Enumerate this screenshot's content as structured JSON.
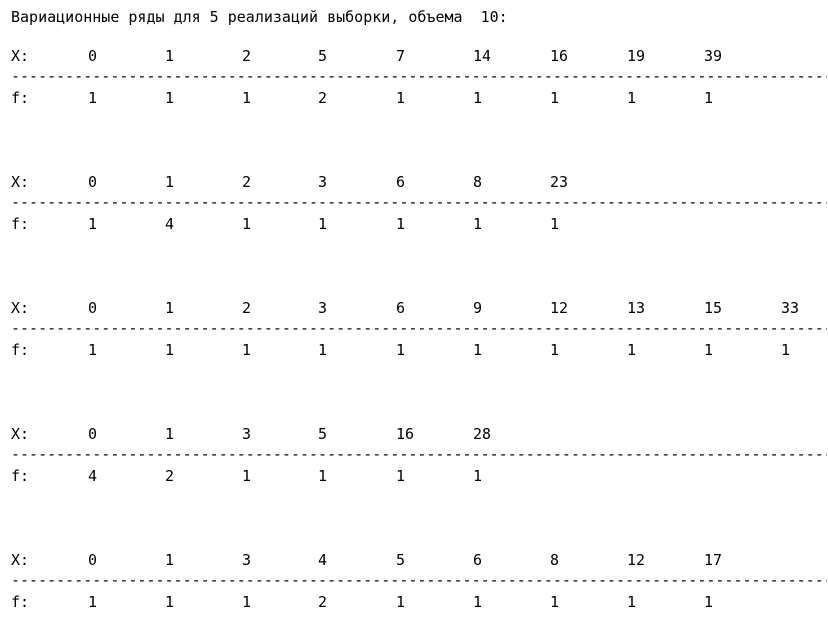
{
  "heading": "Вариационные ряды для 5 реализаций выборки, объема  10:",
  "x_label": "X:",
  "f_label": "f:",
  "separator": "--------------------------------------------------------------------------------------------------------------",
  "samples": [
    {
      "x": [
        "0",
        "1",
        "2",
        "5",
        "7",
        "14",
        "16",
        "19",
        "39"
      ],
      "f": [
        "1",
        "1",
        "1",
        "2",
        "1",
        "1",
        "1",
        "1",
        "1"
      ]
    },
    {
      "x": [
        "0",
        "1",
        "2",
        "3",
        "6",
        "8",
        "23"
      ],
      "f": [
        "1",
        "4",
        "1",
        "1",
        "1",
        "1",
        "1"
      ]
    },
    {
      "x": [
        "0",
        "1",
        "2",
        "3",
        "6",
        "9",
        "12",
        "13",
        "15",
        "33"
      ],
      "f": [
        "1",
        "1",
        "1",
        "1",
        "1",
        "1",
        "1",
        "1",
        "1",
        "1"
      ]
    },
    {
      "x": [
        "0",
        "1",
        "3",
        "5",
        "16",
        "28"
      ],
      "f": [
        "4",
        "2",
        "1",
        "1",
        "1",
        "1"
      ]
    },
    {
      "x": [
        "0",
        "1",
        "3",
        "4",
        "5",
        "6",
        "8",
        "12",
        "17"
      ],
      "f": [
        "1",
        "1",
        "1",
        "2",
        "1",
        "1",
        "1",
        "1",
        "1"
      ]
    }
  ]
}
